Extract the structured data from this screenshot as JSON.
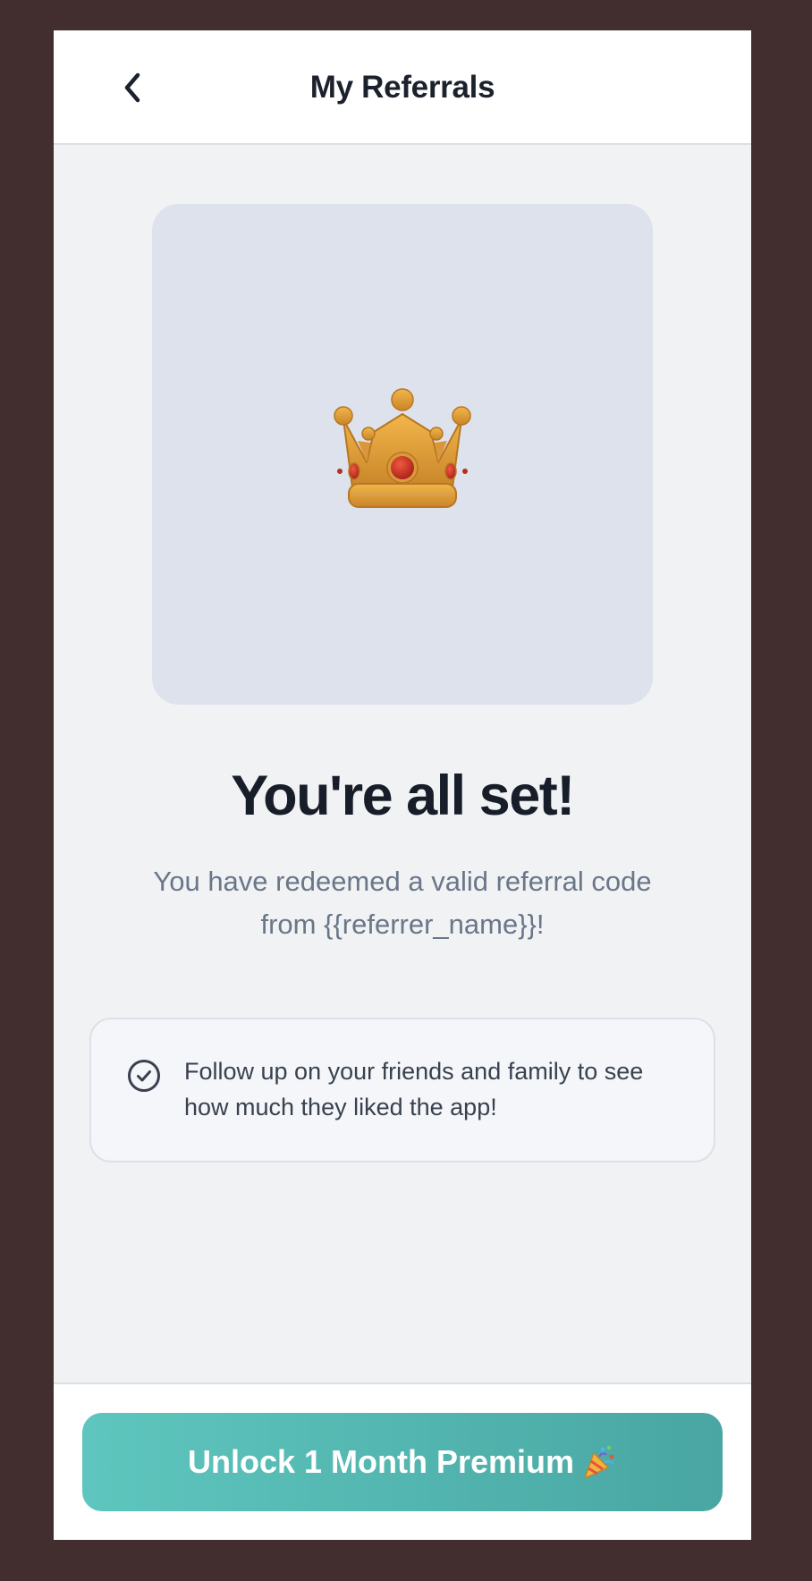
{
  "header": {
    "title": "My Referrals",
    "back_icon": "chevron-left-icon"
  },
  "hero": {
    "icon": "crown-icon"
  },
  "main": {
    "heading": "You're all set!",
    "subtext": "You have redeemed a valid referral code from {{referrer_name}}!"
  },
  "info_card": {
    "icon": "check-circle-icon",
    "text": "Follow up on your friends and family to see how much they liked the app!"
  },
  "footer": {
    "cta_label": "Unlock 1 Month Premium",
    "cta_icon": "party-popper-icon"
  },
  "colors": {
    "page_background": "#422e2e",
    "screen_background": "#f1f2f4",
    "hero_background": "#dde2ec",
    "accent_start": "#5ec6be",
    "accent_end": "#49a6a2",
    "heading_text": "#181e29",
    "muted_text": "#6a7689"
  }
}
